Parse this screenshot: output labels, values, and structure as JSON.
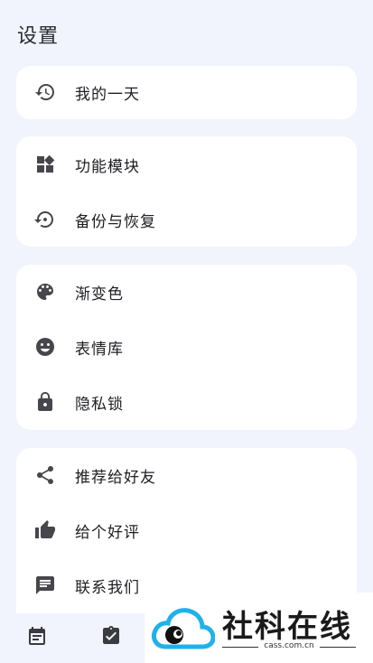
{
  "page": {
    "title": "设置"
  },
  "groups": [
    {
      "items": [
        {
          "icon": "history-icon",
          "label": "我的一天"
        }
      ]
    },
    {
      "items": [
        {
          "icon": "widgets-icon",
          "label": "功能模块"
        },
        {
          "icon": "backup-restore-icon",
          "label": "备份与恢复"
        }
      ]
    },
    {
      "items": [
        {
          "icon": "palette-icon",
          "label": "渐变色"
        },
        {
          "icon": "emoji-icon",
          "label": "表情库"
        },
        {
          "icon": "lock-icon",
          "label": "隐私锁"
        }
      ]
    },
    {
      "items": [
        {
          "icon": "share-icon",
          "label": "推荐给好友"
        },
        {
          "icon": "thumb-up-icon",
          "label": "给个好评"
        },
        {
          "icon": "feedback-icon",
          "label": "联系我们"
        }
      ]
    }
  ],
  "bottom_nav": [
    {
      "icon": "calendar-icon"
    },
    {
      "icon": "clipboard-check-icon"
    }
  ],
  "watermark": {
    "text": "社科在线",
    "url": "cass.com.cn"
  }
}
